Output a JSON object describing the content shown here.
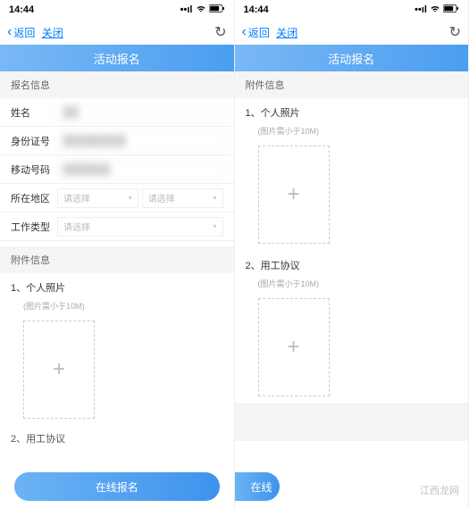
{
  "status": {
    "time": "14:44",
    "signal": "▪▪▪▪",
    "wifi": "📶",
    "battery": "🔋"
  },
  "nav": {
    "back": "返回",
    "close": "关闭"
  },
  "header": {
    "title": "活动报名"
  },
  "left": {
    "section1_title": "报名信息",
    "fields": {
      "name_label": "姓名",
      "name_value": "██",
      "id_label": "身份证号",
      "id_value": "████████",
      "mobile_label": "移动号码",
      "mobile_value": "██████",
      "region_label": "所在地区",
      "region_placeholder1": "请选择",
      "region_placeholder2": "请选择",
      "worktype_label": "工作类型",
      "worktype_placeholder": "请选择"
    },
    "section2_title": "附件信息",
    "attach1_title": "1、个人照片",
    "attach1_hint": "(图片需小于10M)",
    "attach2_peek": "2、用工协议",
    "submit_label": "在线报名"
  },
  "right": {
    "section_title": "附件信息",
    "attach1_title": "1、个人照片",
    "attach1_hint": "(图片需小于10M)",
    "attach2_title": "2、用工协议",
    "attach2_hint": "(图片需小于10M)",
    "submit_partial": "在线"
  },
  "watermark": "江西龙网"
}
